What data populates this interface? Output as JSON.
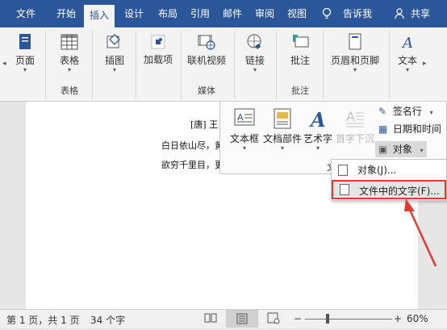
{
  "tabs": [
    {
      "label": "文件"
    },
    {
      "label": "开始"
    },
    {
      "label": "插入"
    },
    {
      "label": "设计"
    },
    {
      "label": "布局"
    },
    {
      "label": "引用"
    },
    {
      "label": "邮件"
    },
    {
      "label": "审阅"
    },
    {
      "label": "视图"
    }
  ],
  "tell_me": "告诉我",
  "share": "共享",
  "ribbon": {
    "pages": "页面",
    "table": "表格",
    "table_group": "表格",
    "illustrations": "插图",
    "addins": "加载项",
    "online_video": "联机视频",
    "media_group": "媒体",
    "links": "链接",
    "comment": "批注",
    "comments_group": "批注",
    "header_footer": "页眉和页脚",
    "text": "文本"
  },
  "text_panel": {
    "textbox": "文本框",
    "quick_parts": "文档部件",
    "wordart": "艺术字",
    "dropcap": "首字下沉",
    "signature_line": "签名行",
    "date_time": "日期和时间",
    "object": "对象",
    "group_label": "文"
  },
  "menu": {
    "object_item": "对象(J)...",
    "text_from_file": "文件中的文字(F)..."
  },
  "document": {
    "author": "[唐] 王",
    "line1": "白日依山尽，黄",
    "line2": "欲穷千里目，更"
  },
  "status": {
    "page": "第 1 页，共 1 页",
    "words": "34 个字",
    "zoom": "60%"
  },
  "colors": {
    "ribbon_blue": "#2b579a",
    "highlight_red": "#e23b2e"
  }
}
